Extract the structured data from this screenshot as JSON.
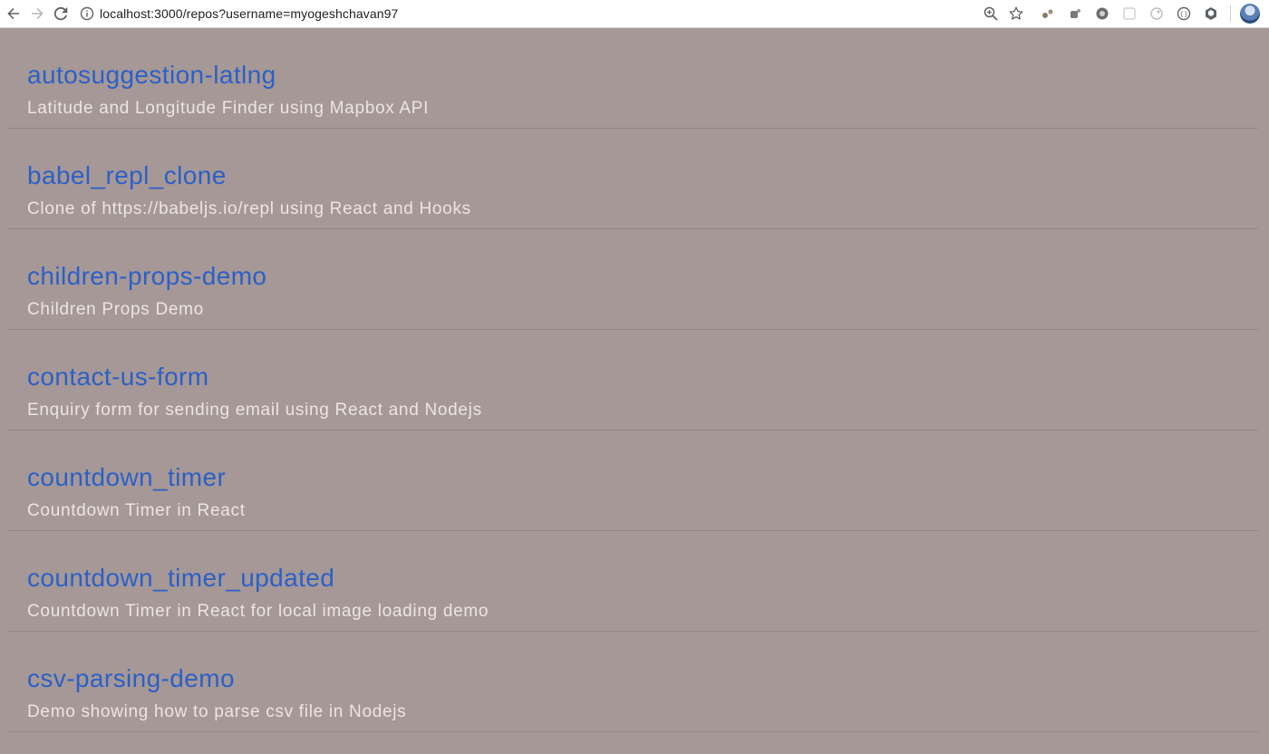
{
  "browser": {
    "url": "localhost:3000/repos?username=myogeshchavan97",
    "icons": {
      "back": "back-arrow-icon",
      "forward": "forward-arrow-icon",
      "reload": "reload-icon",
      "info": "info-icon",
      "zoom": "zoom-icon",
      "bookmark": "star-icon"
    },
    "extensions": [
      "extension-1-icon",
      "extension-2-icon",
      "extension-3-icon",
      "extension-4-icon",
      "extension-5-icon",
      "extension-6-icon",
      "extension-7-icon"
    ]
  },
  "repos": [
    {
      "name": "autosuggestion-latlng",
      "description": "Latitude and Longitude Finder using Mapbox API"
    },
    {
      "name": "babel_repl_clone",
      "description": "Clone of https://babeljs.io/repl using React and Hooks"
    },
    {
      "name": "children-props-demo",
      "description": "Children Props Demo"
    },
    {
      "name": "contact-us-form",
      "description": "Enquiry form for sending email using React and Nodejs"
    },
    {
      "name": "countdown_timer",
      "description": "Countdown Timer in React"
    },
    {
      "name": "countdown_timer_updated",
      "description": "Countdown Timer in React for local image loading demo"
    },
    {
      "name": "csv-parsing-demo",
      "description": "Demo showing how to parse csv file in Nodejs"
    }
  ],
  "colors": {
    "background": "#a69896",
    "link": "#2b60c8",
    "description": "#ece5e3",
    "divider": "#958684"
  }
}
